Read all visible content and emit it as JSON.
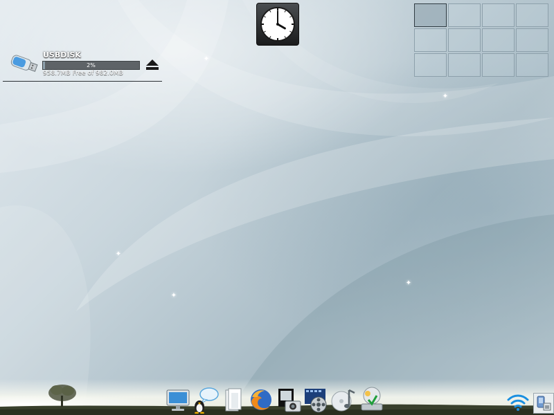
{
  "device": {
    "name": "USBDISK",
    "usage_percent_text": "2%",
    "usage_fraction": 0.02,
    "free_text": "958.7MB Free of 982.0MB",
    "icon": "usb-stick-icon",
    "eject_icon": "eject-icon"
  },
  "clock": {
    "icon": "clock-icon",
    "hour": 4,
    "minute": 0
  },
  "pager": {
    "rows": 3,
    "columns": 4,
    "active_desktop": 1
  },
  "dock": {
    "items": [
      {
        "icon": "computer-monitor-icon"
      },
      {
        "icon": "chat-tux-icon"
      },
      {
        "icon": "document-files-icon"
      },
      {
        "icon": "firefox-browser-icon"
      },
      {
        "icon": "photo-camera-icon"
      },
      {
        "icon": "film-reel-icon"
      },
      {
        "icon": "music-note-disc-icon"
      },
      {
        "icon": "live-installer-icon"
      }
    ]
  },
  "tray": {
    "wifi_icon": "wifi-signal-icon",
    "device_notifier_icon": "device-notifier-icon"
  },
  "colors": {
    "wallpaper_light": "#e3eaef",
    "wallpaper_mid": "#a9bcc6",
    "usage_bar_bg": "#5e6367",
    "wifi_blue": "#1a8fe0"
  }
}
